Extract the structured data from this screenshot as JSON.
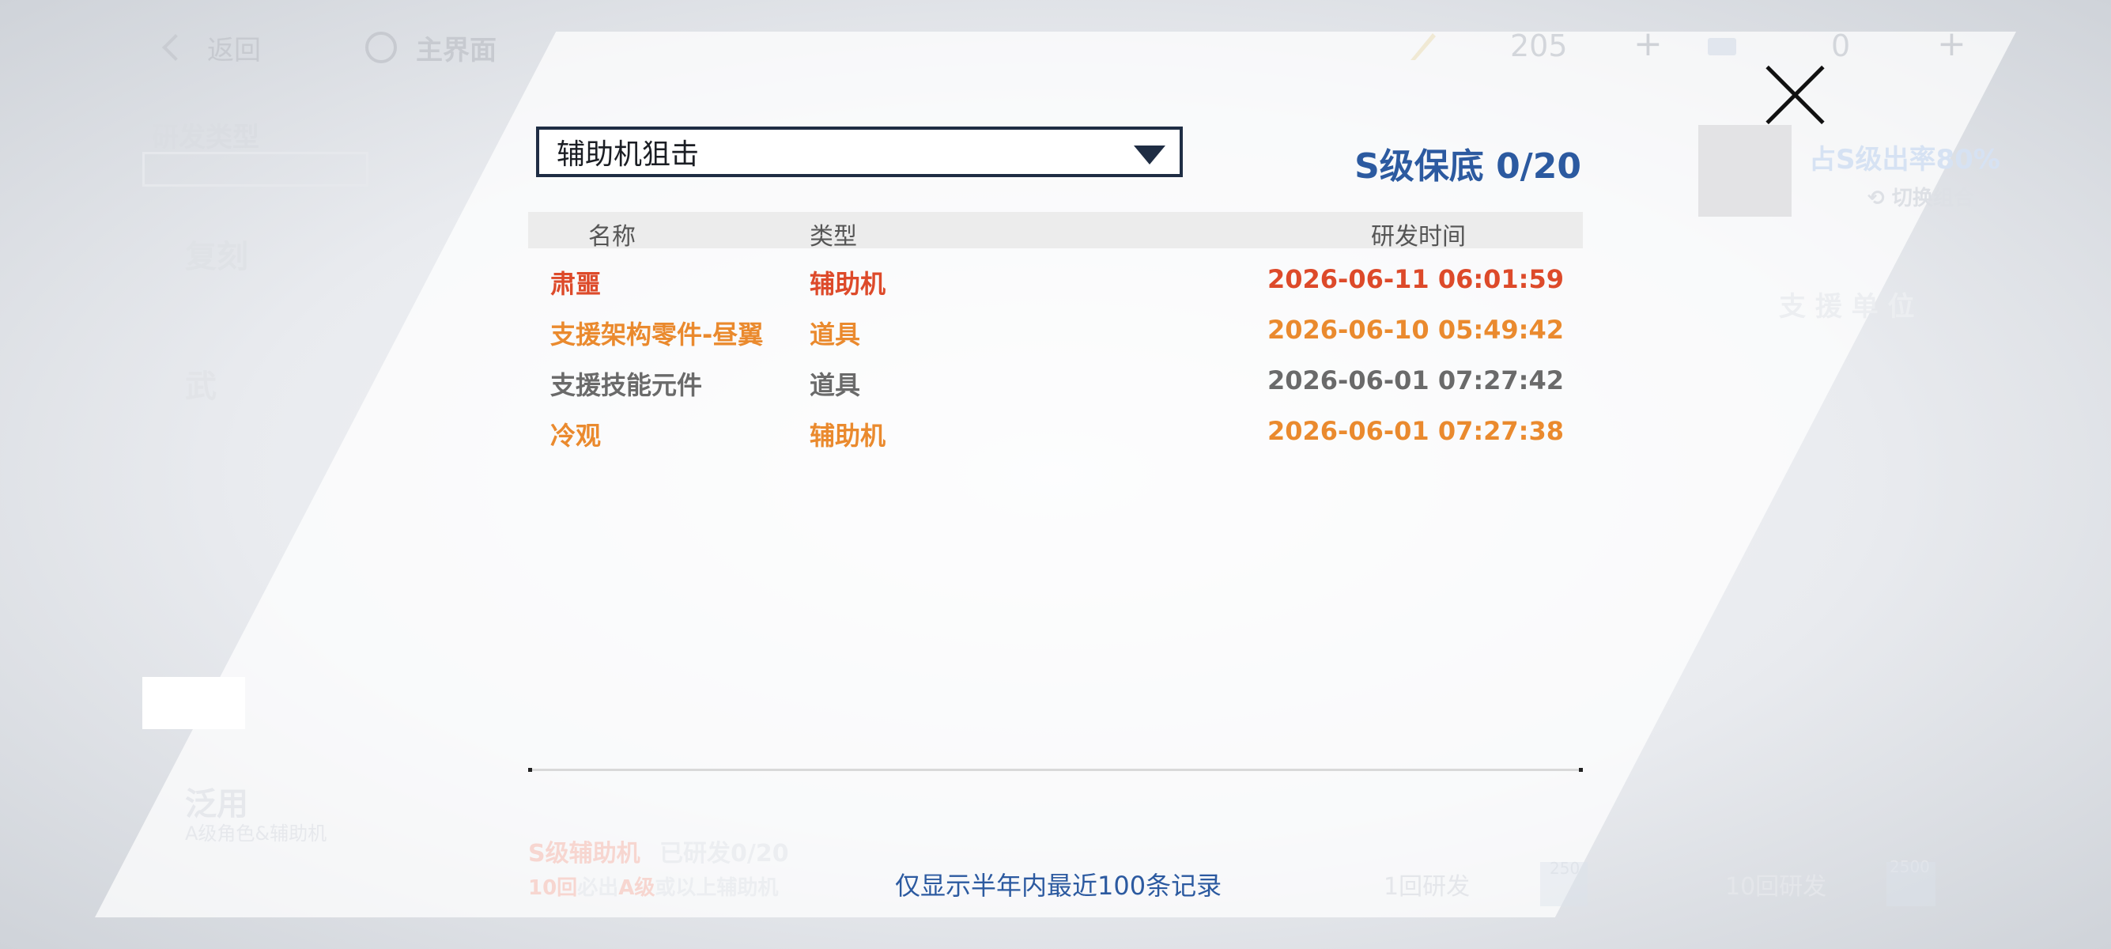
{
  "topbar": {
    "back_label": "返回",
    "home_label": "主界面",
    "resource1_value": "205",
    "resource2_value": "0",
    "plus_symbol": "+"
  },
  "background": {
    "research_type_title": "研发类型",
    "menu_items": [
      "复刻",
      "武",
      "泛用"
    ],
    "generic_subtitle": "A级角色&辅助机",
    "s_rate": "占S级出率80%",
    "switch_combo": "切换组合",
    "support_unit": "支 援 单 位",
    "pity_hint_red": "S级辅助机",
    "pity_hint_gray": "已研发0/20",
    "guarantee_prefix": "10回",
    "guarantee_mid1": "必出",
    "guarantee_mid2": "A级",
    "guarantee_suffix": "或以上辅助机",
    "pull1_label": "1回研发",
    "pull1_cost": "250",
    "pull10_label": "10回研发",
    "pull10_cost": "2500"
  },
  "modal": {
    "dropdown_value": "辅助机狙击",
    "pity_text": "S级保底 0/20",
    "columns": {
      "name": "名称",
      "type": "类型",
      "time": "研发时间"
    },
    "records": [
      {
        "name": "肃噩",
        "type": "辅助机",
        "time": "2026-06-11 06:01:59",
        "rarity": "S"
      },
      {
        "name": "支援架构零件-昼翼",
        "type": "道具",
        "time": "2026-06-10 05:49:42",
        "rarity": "A"
      },
      {
        "name": "支援技能元件",
        "type": "道具",
        "time": "2026-06-01 07:27:42",
        "rarity": "B"
      },
      {
        "name": "冷观",
        "type": "辅助机",
        "time": "2026-06-01 07:27:38",
        "rarity": "A"
      }
    ],
    "footer_note": "仅显示半年内最近100条记录"
  },
  "colors": {
    "s_rank": "#dd4a2a",
    "a_rank": "#ea8a2e",
    "b_rank": "#6a6a6a",
    "accent_blue": "#2c5aa0",
    "frame_navy": "#1f2d44"
  },
  "icons": [
    "back-chevron-icon",
    "home-circle-icon",
    "feather-resource-icon",
    "ticket-resource-icon",
    "close-icon",
    "dropdown-arrow-icon",
    "switch-icon"
  ]
}
